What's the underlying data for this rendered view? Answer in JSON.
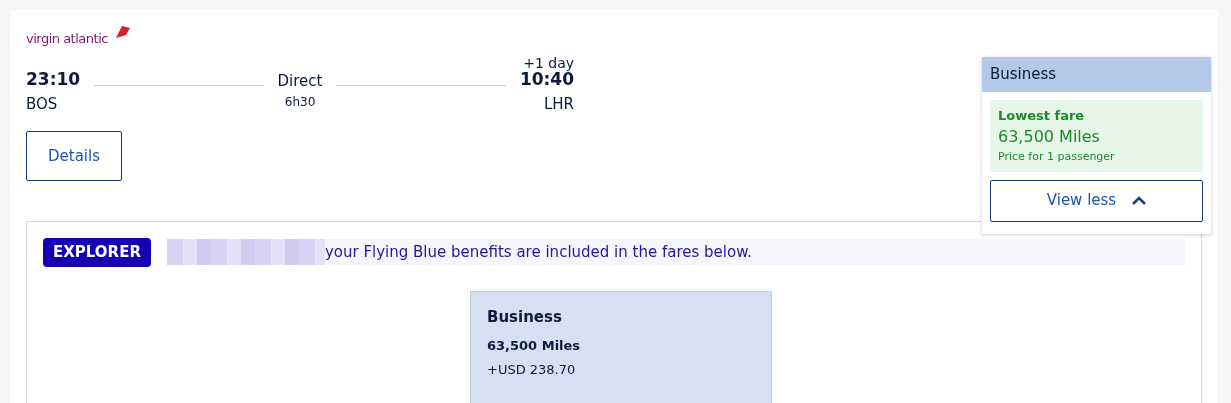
{
  "airline": {
    "logo_text": "virgin atlantic"
  },
  "flight": {
    "departure_time": "23:10",
    "departure_airport": "BOS",
    "stops": "Direct",
    "duration": "6h30",
    "day_offset": "+1 day",
    "arrival_time": "10:40",
    "arrival_airport": "LHR"
  },
  "details_button": "Details",
  "fare_popup": {
    "cabin": "Business",
    "highlight_label": "Lowest fare",
    "price": "63,500 Miles",
    "note": "Price for 1 passenger",
    "toggle_button": "View less",
    "expanded": true
  },
  "benefits": {
    "badge": "EXPLORER",
    "message": "your Flying Blue benefits are included in the fares below."
  },
  "fares": [
    {
      "cabin": "Business",
      "miles": "63,500 Miles",
      "tax": "+USD 238.70"
    }
  ]
}
